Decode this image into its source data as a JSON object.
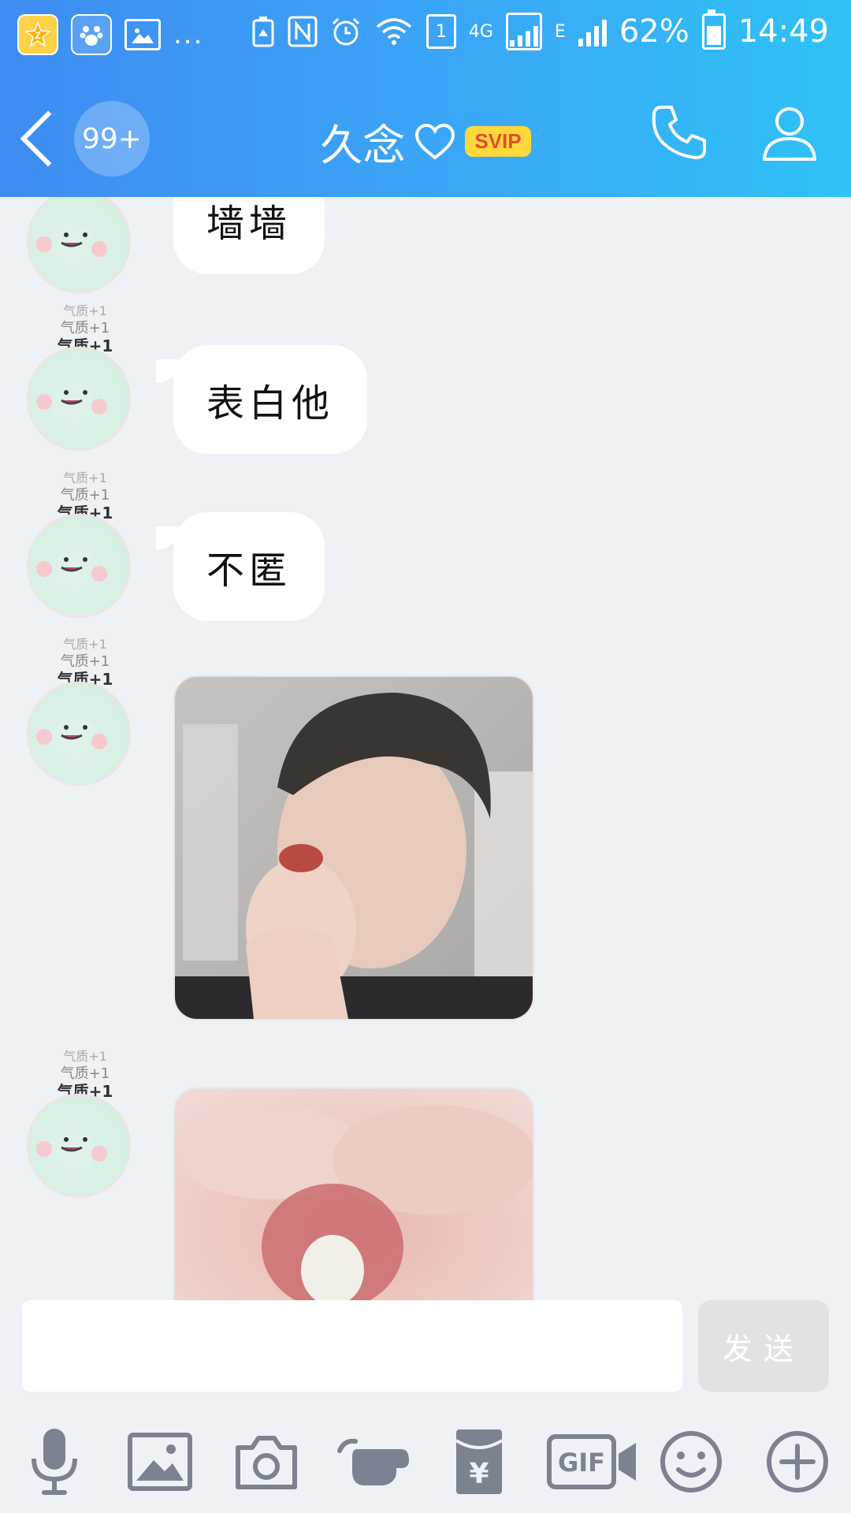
{
  "status_bar": {
    "left_icons": [
      "qzone-icon",
      "baidu-icon",
      "gallery-icon"
    ],
    "more": "...",
    "network_sim_slot": "1",
    "network_4g": "4G",
    "network_e": "E",
    "battery_percent": "62%",
    "time": "14:49"
  },
  "header": {
    "unread_count": "99+",
    "contact_name": "久念",
    "vip_badge": "SVIP",
    "accent_color": "#3aa7f6"
  },
  "messages": [
    {
      "type": "text",
      "text": "墙墙"
    },
    {
      "type": "text",
      "text": "表白他",
      "labels": [
        "气质+1",
        "气质+1",
        "气质+1"
      ]
    },
    {
      "type": "text",
      "text": "不匿",
      "labels": [
        "气质+1",
        "气质+1",
        "气质+1"
      ]
    },
    {
      "type": "image",
      "labels": [
        "气质+1",
        "气质+1",
        "气质+1"
      ]
    },
    {
      "type": "image",
      "labels": [
        "气质+1",
        "气质+1",
        "气质+1"
      ]
    }
  ],
  "composer": {
    "placeholder": "",
    "send_label": "发送"
  },
  "toolbar": {
    "items": [
      "microphone-icon",
      "image-icon",
      "camera-icon",
      "poke-icon",
      "red-packet-icon",
      "gif-icon",
      "emoji-icon",
      "plus-icon"
    ],
    "gif_label": "GIF",
    "red_packet_symbol": "¥"
  }
}
